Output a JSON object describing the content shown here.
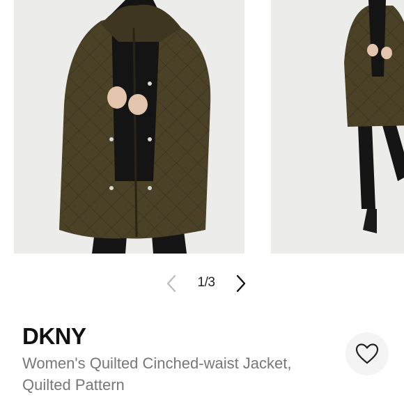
{
  "carousel": {
    "counter": "1/3",
    "prev_icon": "chevron-left-icon",
    "next_icon": "chevron-right-icon"
  },
  "product": {
    "brand": "DKNY",
    "title": "Women's Quilted Cinched-waist Jacket, Quilted Pattern"
  },
  "actions": {
    "like_icon": "heart-icon"
  },
  "colors": {
    "jacket": "#4a4127",
    "background": "#ececeb",
    "brand_text": "#111111",
    "title_text": "#777777"
  }
}
